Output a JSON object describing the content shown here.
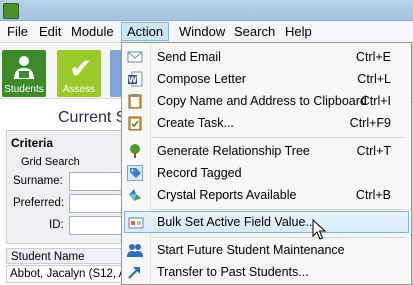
{
  "menubar": {
    "items": [
      "File",
      "Edit",
      "Module",
      "Action",
      "Window",
      "Search",
      "Help"
    ],
    "active_index": 3
  },
  "toolbar": {
    "students_label": "Students",
    "assess_label": "Assess"
  },
  "panel": {
    "title": "Current St",
    "criteria_label": "Criteria",
    "grid_search_label": "Grid Search",
    "surname_label": "Surname:",
    "preferred_label": "Preferred:",
    "id_label": "ID:",
    "column_header": "Student Name",
    "row_value": "Abbot, Jacalyn (S12, A"
  },
  "action_menu": {
    "send_email": {
      "label": "Send Email",
      "shortcut": "Ctrl+E",
      "icon": "envelope-icon"
    },
    "compose_letter": {
      "label": "Compose Letter",
      "shortcut": "Ctrl+L",
      "icon": "word-document-icon"
    },
    "copy_address": {
      "label": "Copy Name and Address to Clipboard",
      "shortcut": "Ctrl+I",
      "icon": "clipboard-icon"
    },
    "create_task": {
      "label": "Create Task...",
      "shortcut": "Ctrl+F9",
      "icon": "task-clipboard-icon"
    },
    "relationship_tree": {
      "label": "Generate Relationship Tree",
      "shortcut": "Ctrl+T",
      "icon": "tree-icon"
    },
    "record_tagged": {
      "label": "Record Tagged",
      "shortcut": "",
      "icon": "tag-icon"
    },
    "crystal_reports": {
      "label": "Crystal Reports Available",
      "shortcut": "Ctrl+B",
      "icon": "crystal-reports-icon"
    },
    "bulk_set": {
      "label": "Bulk Set Active Field Value...",
      "shortcut": "",
      "icon": "bulk-edit-icon"
    },
    "future_maintenance": {
      "label": "Start Future Student Maintenance",
      "shortcut": "",
      "icon": "users-icon"
    },
    "transfer_past": {
      "label": "Transfer to Past Students...",
      "shortcut": "",
      "icon": "arrow-up-right-icon"
    }
  },
  "colors": {
    "menu_highlight": "#cde6f7",
    "students_tile": "#3e8a2a",
    "assess_tile": "#9ac92b"
  }
}
